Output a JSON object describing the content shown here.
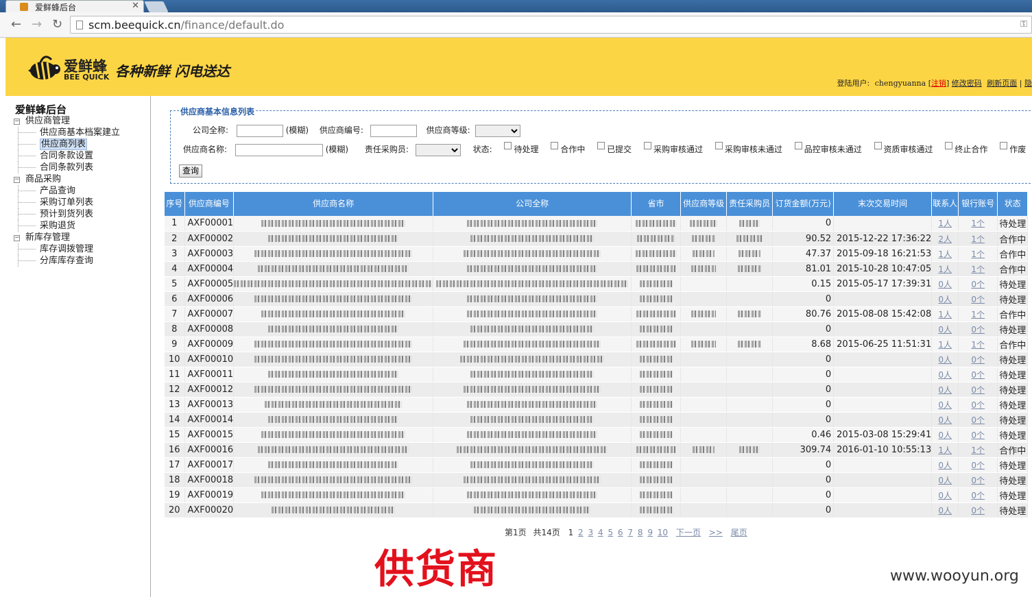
{
  "browser": {
    "tab_title": "爱鲜蜂后台",
    "url_host": "scm.beequick.cn",
    "url_path": "/finance/default.do"
  },
  "header": {
    "logo_cn": "爱鲜蜂",
    "logo_en": "BEE QUICK",
    "slogan": "各种新鲜 闪电送达",
    "login_label": "登陆用户:",
    "username": "chengyuanna",
    "logout": "注销",
    "change_password": "修改密码",
    "refresh": "刷新页面",
    "more": "隐"
  },
  "sidebar": {
    "title": "爱鲜蜂后台",
    "groups": [
      {
        "label": "供应商管理",
        "items": [
          "供应商基本档案建立",
          "供应商列表",
          "合同条款设置",
          "合同条款列表"
        ]
      },
      {
        "label": "商品采购",
        "items": [
          "产品查询",
          "采购订单列表",
          "预计到货列表",
          "采购退货"
        ]
      },
      {
        "label": "新库存管理",
        "items": [
          "库存调拨管理",
          "分库库存查询"
        ]
      }
    ]
  },
  "filter": {
    "legend": "供应商基本信息列表",
    "company_label": "公司全称:",
    "fuzzy": "(模糊)",
    "code_label": "供应商编号:",
    "level_label": "供应商等级:",
    "name_label": "供应商名称:",
    "buyer_label": "责任采购员:",
    "status_label": "状态:",
    "statuses": [
      "待处理",
      "合作中",
      "已提交",
      "采购审核通过",
      "采购审核未通过",
      "品控审核未通过",
      "资质审核通过",
      "终止合作",
      "作废"
    ],
    "query": "查询"
  },
  "table": {
    "headers": [
      "序号",
      "供应商编号",
      "供应商名称",
      "公司全称",
      "省市",
      "供应商等级",
      "责任采购员",
      "订货金额(万元)",
      "末次交易时间",
      "联系人",
      "银行账号",
      "状态"
    ],
    "rows": [
      {
        "no": "1",
        "code": "AXF00001",
        "amount": "0",
        "last": "",
        "contact": "1人",
        "bank": "1个",
        "status": "待处理"
      },
      {
        "no": "2",
        "code": "AXF00002",
        "amount": "90.52",
        "last": "2015-12-22 17:36:22",
        "contact": "2人",
        "bank": "1个",
        "status": "合作中"
      },
      {
        "no": "3",
        "code": "AXF00003",
        "amount": "47.37",
        "last": "2015-09-18 16:21:53",
        "contact": "1人",
        "bank": "1个",
        "status": "合作中"
      },
      {
        "no": "4",
        "code": "AXF00004",
        "amount": "81.01",
        "last": "2015-10-28 10:47:05",
        "contact": "1人",
        "bank": "1个",
        "status": "合作中"
      },
      {
        "no": "5",
        "code": "AXF00005",
        "amount": "0.15",
        "last": "2015-05-17 17:39:31",
        "contact": "0人",
        "bank": "0个",
        "status": "待处理"
      },
      {
        "no": "6",
        "code": "AXF00006",
        "amount": "0",
        "last": "",
        "contact": "0人",
        "bank": "0个",
        "status": "待处理"
      },
      {
        "no": "7",
        "code": "AXF00007",
        "amount": "80.76",
        "last": "2015-08-08 15:42:08",
        "contact": "1人",
        "bank": "1个",
        "status": "合作中"
      },
      {
        "no": "8",
        "code": "AXF00008",
        "amount": "0",
        "last": "",
        "contact": "0人",
        "bank": "0个",
        "status": "待处理"
      },
      {
        "no": "9",
        "code": "AXF00009",
        "amount": "8.68",
        "last": "2015-06-25 11:51:31",
        "contact": "1人",
        "bank": "1个",
        "status": "合作中"
      },
      {
        "no": "10",
        "code": "AXF00010",
        "amount": "0",
        "last": "",
        "contact": "0人",
        "bank": "0个",
        "status": "待处理"
      },
      {
        "no": "11",
        "code": "AXF00011",
        "amount": "0",
        "last": "",
        "contact": "0人",
        "bank": "0个",
        "status": "待处理"
      },
      {
        "no": "12",
        "code": "AXF00012",
        "amount": "0",
        "last": "",
        "contact": "0人",
        "bank": "0个",
        "status": "待处理"
      },
      {
        "no": "13",
        "code": "AXF00013",
        "amount": "0",
        "last": "",
        "contact": "0人",
        "bank": "0个",
        "status": "待处理"
      },
      {
        "no": "14",
        "code": "AXF00014",
        "amount": "0",
        "last": "",
        "contact": "0人",
        "bank": "0个",
        "status": "待处理"
      },
      {
        "no": "15",
        "code": "AXF00015",
        "amount": "0.46",
        "last": "2015-03-08 15:29:41",
        "contact": "0人",
        "bank": "0个",
        "status": "待处理"
      },
      {
        "no": "16",
        "code": "AXF00016",
        "amount": "309.74",
        "last": "2016-01-10 10:55:13",
        "contact": "1人",
        "bank": "1个",
        "status": "合作中"
      },
      {
        "no": "17",
        "code": "AXF00017",
        "amount": "0",
        "last": "",
        "contact": "0人",
        "bank": "0个",
        "status": "待处理"
      },
      {
        "no": "18",
        "code": "AXF00018",
        "amount": "0",
        "last": "",
        "contact": "0人",
        "bank": "0个",
        "status": "待处理"
      },
      {
        "no": "19",
        "code": "AXF00019",
        "amount": "0",
        "last": "",
        "contact": "0人",
        "bank": "0个",
        "status": "待处理"
      },
      {
        "no": "20",
        "code": "AXF00020",
        "amount": "0",
        "last": "",
        "contact": "0人",
        "bank": "0个",
        "status": "待处理"
      }
    ]
  },
  "pager": {
    "current": "第1页",
    "total": "共14页",
    "pages": [
      "1",
      "2",
      "3",
      "4",
      "5",
      "6",
      "7",
      "8",
      "9",
      "10"
    ],
    "next": "下一页",
    "jump": ">>",
    "last": "尾页"
  },
  "overlay": {
    "caption": "供货商",
    "site": "www.wooyun.org"
  }
}
